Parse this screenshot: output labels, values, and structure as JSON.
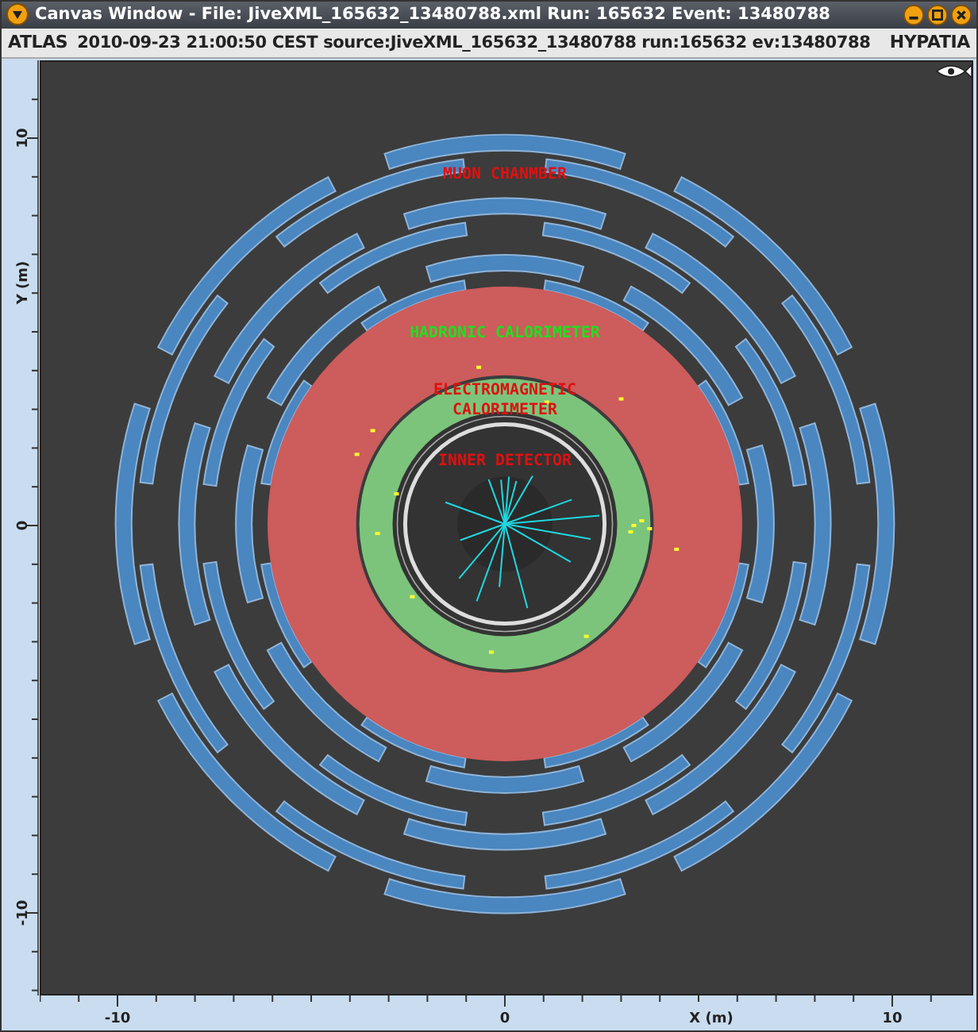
{
  "window": {
    "title": "Canvas Window -  File: JiveXML_165632_13480788.xml  Run: 165632  Event: 13480788"
  },
  "info_bar": {
    "experiment": "ATLAS",
    "event_info": "2010-09-23 21:00:50 CEST source:JiveXML_165632_13480788 run:165632 ev:13480788",
    "app_name": "HYPATIA"
  },
  "display": {
    "labels": [
      {
        "text": "MUON CHANMBER",
        "kind": "muon",
        "color": "#e01010"
      },
      {
        "text": "HADRONIC CALORIMETER",
        "kind": "hadronic",
        "color": "#22dd22"
      },
      {
        "text": "ELECTROMAGNETIC",
        "kind": "em",
        "color": "#e01010"
      },
      {
        "text": "CALORIMETER",
        "kind": "em2",
        "color": "#e01010"
      },
      {
        "text": "INNER DETECTOR",
        "kind": "inner",
        "color": "#e01010"
      }
    ]
  },
  "x_axis": {
    "label": "X (m)",
    "ticks": [
      "-10",
      "0",
      "10"
    ]
  },
  "y_axis": {
    "label": "Y (m)",
    "ticks": [
      "10",
      "0",
      "-10"
    ]
  }
}
